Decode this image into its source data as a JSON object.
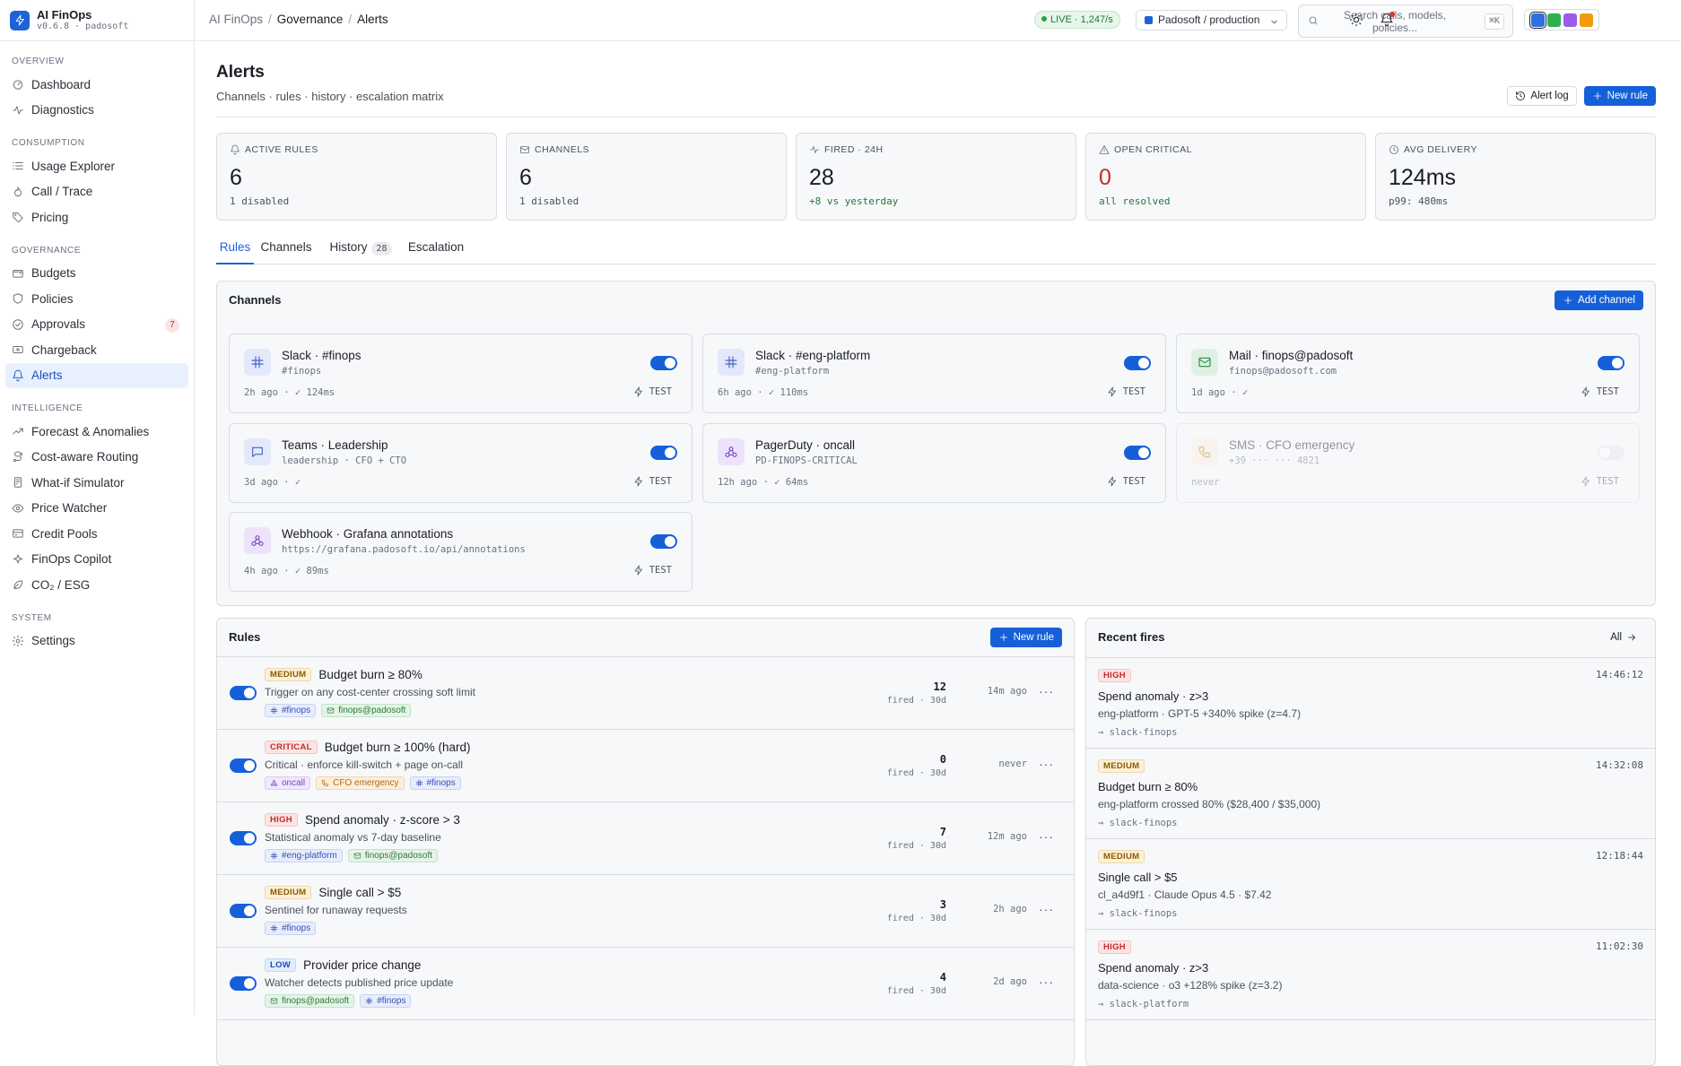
{
  "brand": {
    "name": "AI FinOps",
    "version": "v0.6.8 · padosoft"
  },
  "sidebar": {
    "sections": [
      {
        "title": "OVERVIEW",
        "items": [
          {
            "label": "Dashboard",
            "icon": "gauge-icon"
          },
          {
            "label": "Diagnostics",
            "icon": "pulse-icon"
          }
        ]
      },
      {
        "title": "CONSUMPTION",
        "items": [
          {
            "label": "Usage Explorer",
            "icon": "list-icon"
          },
          {
            "label": "Call / Trace",
            "icon": "flame-icon"
          },
          {
            "label": "Pricing",
            "icon": "tag-icon"
          }
        ]
      },
      {
        "title": "GOVERNANCE",
        "items": [
          {
            "label": "Budgets",
            "icon": "wallet-icon"
          },
          {
            "label": "Policies",
            "icon": "shield-icon"
          },
          {
            "label": "Approvals",
            "icon": "check-circle-icon",
            "badge": "7"
          },
          {
            "label": "Chargeback",
            "icon": "receipt-icon"
          },
          {
            "label": "Alerts",
            "icon": "bell-icon",
            "active": true
          }
        ]
      },
      {
        "title": "INTELLIGENCE",
        "items": [
          {
            "label": "Forecast & Anomalies",
            "icon": "trend-icon"
          },
          {
            "label": "Cost-aware Routing",
            "icon": "route-icon"
          },
          {
            "label": "What-if Simulator",
            "icon": "flask-icon"
          },
          {
            "label": "Price Watcher",
            "icon": "eye-icon"
          },
          {
            "label": "Credit Pools",
            "icon": "card-icon"
          },
          {
            "label": "FinOps Copilot",
            "icon": "sparkle-icon"
          },
          {
            "label": "CO₂ / ESG",
            "icon": "leaf-icon"
          }
        ]
      },
      {
        "title": "SYSTEM",
        "items": [
          {
            "label": "Settings",
            "icon": "gear-icon"
          }
        ]
      }
    ]
  },
  "topbar": {
    "breadcrumb": [
      "AI FinOps",
      "Governance",
      "Alerts"
    ],
    "live": "LIVE · 1,247/s",
    "tenant": "Padosoft / production",
    "search_placeholder": "Search calls, models, policies...",
    "search_shortcut": "⌘K",
    "swatch_colors": [
      "#2f6fe0",
      "#2eb04f",
      "#9b5de5",
      "#f29a0d"
    ]
  },
  "page": {
    "title": "Alerts",
    "subtitle": "Channels · rules · history · escalation matrix",
    "alert_log_label": "Alert log",
    "new_rule_label": "New rule"
  },
  "stats": [
    {
      "label": "ACTIVE RULES",
      "value": "6",
      "note": "1 disabled",
      "icon": "bell-icon"
    },
    {
      "label": "CHANNELS",
      "value": "6",
      "note": "1 disabled",
      "icon": "mail-icon"
    },
    {
      "label": "FIRED · 24H",
      "value": "28",
      "note": "+8 vs yesterday",
      "note_color": "#1e7a36",
      "icon": "pulse-icon"
    },
    {
      "label": "OPEN CRITICAL",
      "value": "0",
      "value_color": "#c42b2b",
      "note": "all resolved",
      "note_color": "#1e7a36",
      "icon": "warning-icon"
    },
    {
      "label": "AVG DELIVERY",
      "value": "124ms",
      "note": "p99: 480ms",
      "icon": "clock-icon"
    }
  ],
  "tabs": [
    {
      "label": "Rules",
      "active": true
    },
    {
      "label": "Channels"
    },
    {
      "label": "History",
      "count": "28"
    },
    {
      "label": "Escalation"
    }
  ],
  "channels_panel": {
    "title": "Channels",
    "add_label": "Add channel",
    "test_label": "TEST",
    "items": [
      {
        "name": "Slack · #finops",
        "sub": "#finops",
        "foot": "2h ago · ✓ 124ms",
        "type": "slack",
        "enabled": true
      },
      {
        "name": "Slack · #eng-platform",
        "sub": "#eng-platform",
        "foot": "6h ago · ✓ 110ms",
        "type": "slack",
        "enabled": true
      },
      {
        "name": "Mail · finops@padosoft",
        "sub": "finops@padosoft.com",
        "foot": "1d ago · ✓",
        "type": "email",
        "enabled": true
      },
      {
        "name": "Teams · Leadership",
        "sub": "leadership · CFO + CTO",
        "foot": "3d ago · ✓",
        "type": "teams",
        "enabled": true
      },
      {
        "name": "PagerDuty · oncall",
        "sub": "PD-FINOPS-CRITICAL",
        "foot": "12h ago · ✓ 64ms",
        "type": "pager",
        "enabled": true
      },
      {
        "name": "SMS · CFO emergency",
        "sub": "+39 ··· ··· 4821",
        "foot": "never",
        "type": "sms",
        "enabled": false
      },
      {
        "name": "Webhook · Grafana annotations",
        "sub": "https://grafana.padosoft.io/api/annotations",
        "foot": "4h ago · ✓ 89ms",
        "type": "webhook",
        "enabled": true
      }
    ]
  },
  "rules_panel": {
    "title": "Rules",
    "new_rule_label": "New rule",
    "items": [
      {
        "severity": "MEDIUM",
        "name": "Budget burn ≥ 80%",
        "desc": "Trigger on any cost-center crossing soft limit",
        "channels": [
          {
            "label": "#finops",
            "type": "slack"
          },
          {
            "label": "finops@padosoft",
            "type": "email"
          }
        ],
        "count": "12",
        "count_label": "fired · 30d",
        "last": "14m ago",
        "enabled": true
      },
      {
        "severity": "CRITICAL",
        "name": "Budget burn ≥ 100% (hard)",
        "desc": "Critical · enforce kill-switch + page on-call",
        "channels": [
          {
            "label": "oncall",
            "type": "pager"
          },
          {
            "label": "CFO emergency",
            "type": "sms"
          },
          {
            "label": "#finops",
            "type": "slack"
          }
        ],
        "count": "0",
        "count_label": "fired · 30d",
        "last": "never",
        "enabled": true
      },
      {
        "severity": "HIGH",
        "name": "Spend anomaly · z-score > 3",
        "desc": "Statistical anomaly vs 7-day baseline",
        "channels": [
          {
            "label": "#eng-platform",
            "type": "slack"
          },
          {
            "label": "finops@padosoft",
            "type": "email"
          }
        ],
        "count": "7",
        "count_label": "fired · 30d",
        "last": "12m ago",
        "enabled": true
      },
      {
        "severity": "MEDIUM",
        "name": "Single call > $5",
        "desc": "Sentinel for runaway requests",
        "channels": [
          {
            "label": "#finops",
            "type": "slack"
          }
        ],
        "count": "3",
        "count_label": "fired · 30d",
        "last": "2h ago",
        "enabled": true
      },
      {
        "severity": "LOW",
        "name": "Provider price change",
        "desc": "Watcher detects published price update",
        "channels": [
          {
            "label": "finops@padosoft",
            "type": "email"
          },
          {
            "label": "#finops",
            "type": "slack"
          }
        ],
        "count": "4",
        "count_label": "fired · 30d",
        "last": "2d ago",
        "enabled": true
      }
    ]
  },
  "fires_panel": {
    "title": "Recent fires",
    "all_label": "All",
    "items": [
      {
        "severity": "HIGH",
        "time": "14:46:12",
        "title": "Spend anomaly · z>3",
        "detail": "eng-platform · GPT-5 +340% spike (z=4.7)",
        "route": "→ slack-finops"
      },
      {
        "severity": "MEDIUM",
        "time": "14:32:08",
        "title": "Budget burn ≥ 80%",
        "detail": "eng-platform crossed 80% ($28,400 / $35,000)",
        "route": "→ slack-finops"
      },
      {
        "severity": "MEDIUM",
        "time": "12:18:44",
        "title": "Single call > $5",
        "detail": "cl_a4d9f1 · Claude Opus 4.5 · $7.42",
        "route": "→ slack-finops"
      },
      {
        "severity": "HIGH",
        "time": "11:02:30",
        "title": "Spend anomaly · z>3",
        "detail": "data-science · o3 +128% spike (z=3.2)",
        "route": "→ slack-platform"
      }
    ]
  }
}
